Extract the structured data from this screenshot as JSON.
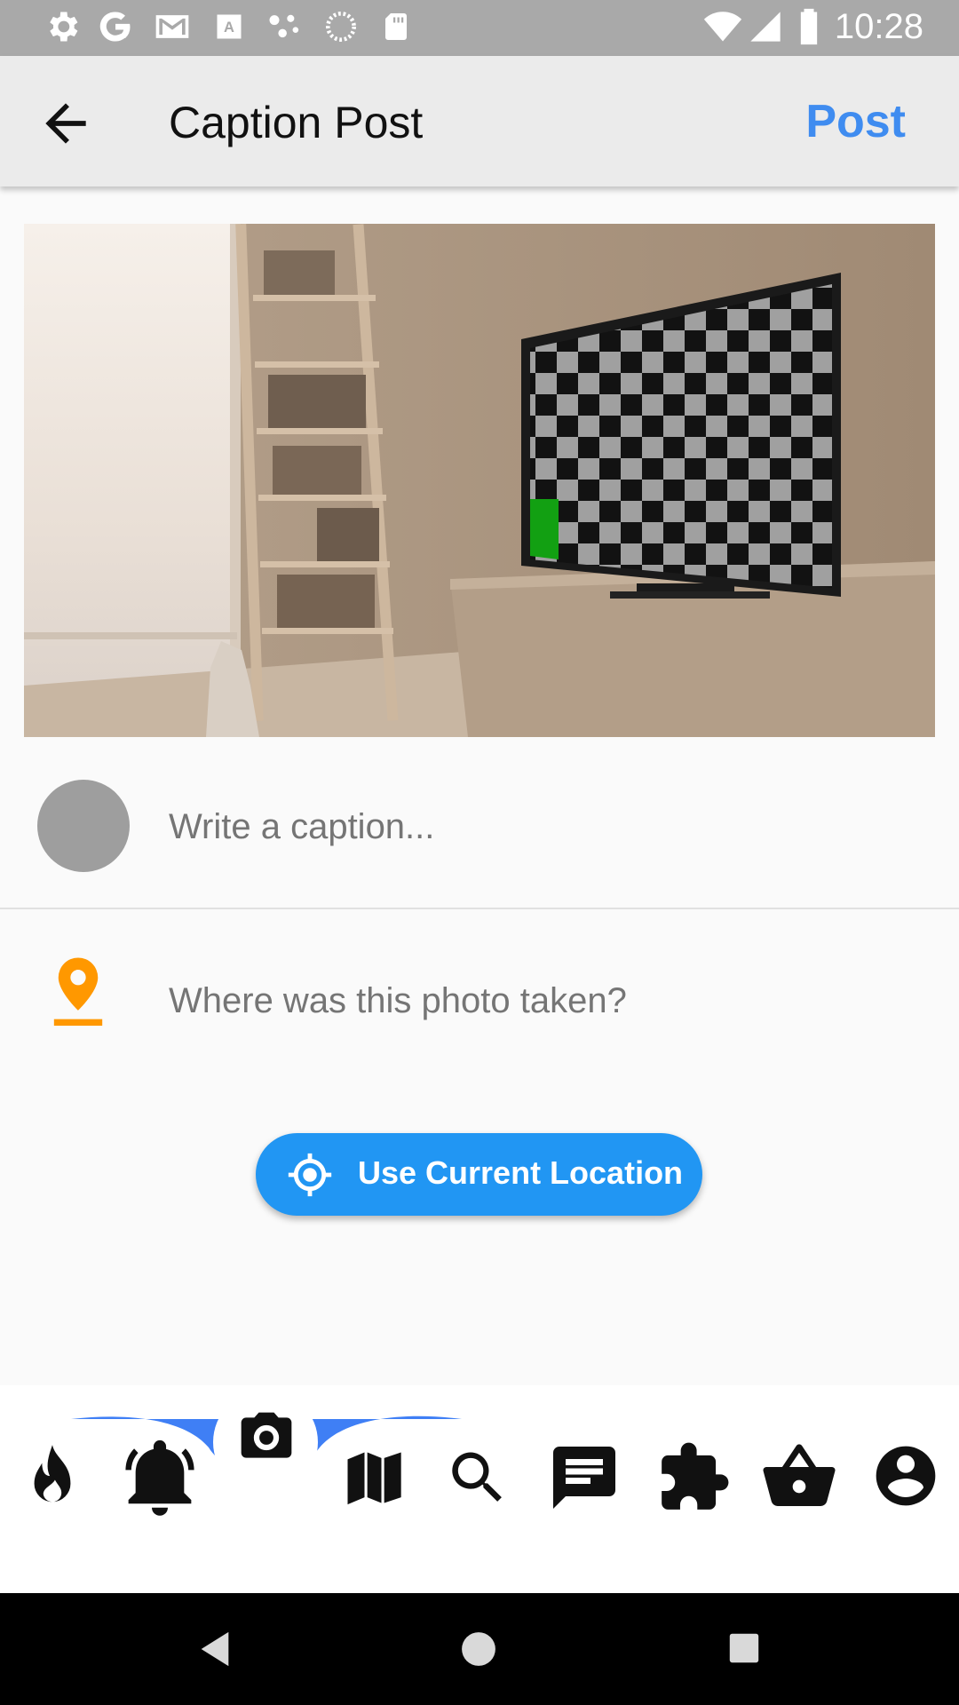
{
  "status_bar": {
    "time": "10:28",
    "left_icons": [
      "settings-icon",
      "google-icon",
      "gmail-icon",
      "font-icon",
      "dots-icon",
      "loading-icon",
      "sd-card-icon"
    ],
    "right_icons": [
      "wifi-icon",
      "signal-icon",
      "battery-icon"
    ]
  },
  "app_bar": {
    "title": "Caption Post",
    "post_label": "Post",
    "back_icon": "arrow-back-icon"
  },
  "caption": {
    "placeholder": "Write a caption...",
    "value": ""
  },
  "location": {
    "placeholder": "Where was this photo taken?",
    "value": "",
    "icon": "location-pin-icon",
    "button_label": "Use Current Location",
    "button_icon": "gps-target-icon"
  },
  "bottom_nav": {
    "items": [
      "flame-icon",
      "bell-icon",
      "camera-icon",
      "map-icon",
      "search-icon",
      "chat-icon",
      "puzzle-icon",
      "basket-icon",
      "account-icon"
    ],
    "active": "camera-icon"
  },
  "colors": {
    "accent": "#3f8cf0",
    "button": "#2196f3",
    "pin": "#ff9800",
    "wave": "#3f7ff5",
    "status_bar": "#a9a9a9",
    "app_bar": "#ebebeb"
  }
}
